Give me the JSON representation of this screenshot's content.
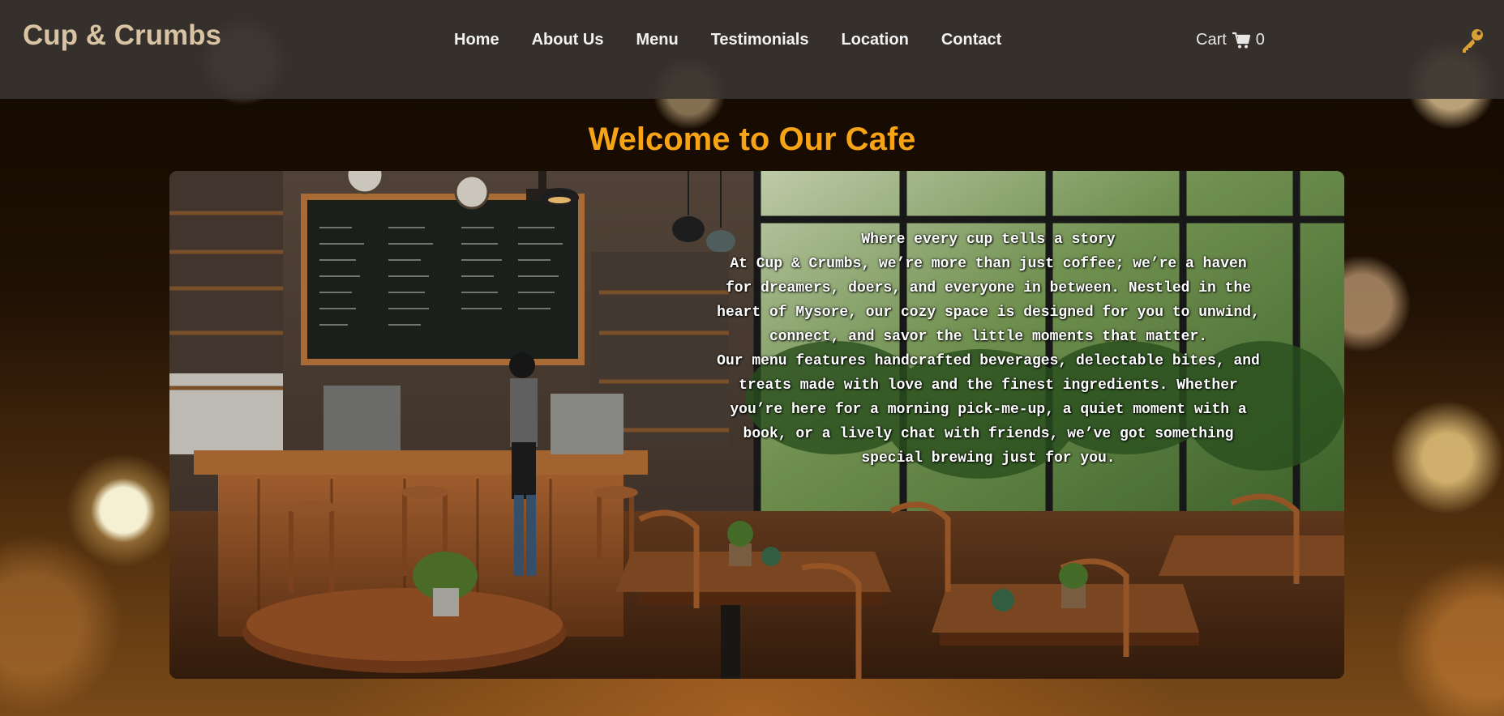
{
  "header": {
    "logo": "Cup & Crumbs",
    "nav": [
      {
        "label": "Home"
      },
      {
        "label": "About Us"
      },
      {
        "label": "Menu"
      },
      {
        "label": "Testimonials"
      },
      {
        "label": "Location"
      },
      {
        "label": "Contact"
      }
    ],
    "cart": {
      "label": "Cart",
      "icon": "cart-icon",
      "count": "0"
    },
    "key_icon": "key-icon"
  },
  "main": {
    "title": "Welcome to Our Cafe",
    "hero_image": "cafe-interior-image",
    "story": {
      "heading": "Where every cup tells a story",
      "paragraph1": "At Cup & Crumbs, we’re more than just coffee; we’re a haven for dreamers, doers, and everyone in between. Nestled in the heart of Mysore, our cozy space is designed for you to unwind, connect, and savor the little moments that matter.",
      "paragraph2": "Our menu features handcrafted beverages, delectable bites, and treats made with love and the finest ingredients. Whether you’re here for a morning pick-me-up, a quiet moment with a book, or a lively chat with friends, we’ve got something special brewing just for you."
    }
  },
  "colors": {
    "accent_title": "#f6a316",
    "logo": "#d8c3a2",
    "topbar": "#3a3430",
    "key": "#d9a036"
  }
}
